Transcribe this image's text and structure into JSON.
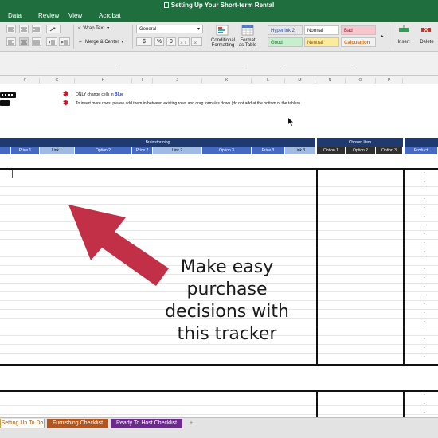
{
  "window": {
    "title": "Setting Up Your Short-term Rental"
  },
  "menu": [
    "Data",
    "Review",
    "View",
    "Acrobat"
  ],
  "ribbon": {
    "wrap_text": "Wrap Text",
    "merge_center": "Merge & Center",
    "number_format": "General",
    "currency": "$",
    "percent": "%",
    "comma": "9",
    "conditional_formatting": "Conditional Formatting",
    "format_as_table": "Format as Table",
    "styles": {
      "hyperlink2": "Hyperlink 2",
      "normal": "Normal",
      "bad": "Bad",
      "good": "Good",
      "neutral": "Neutral",
      "calculation": "Calculation"
    },
    "insert": "Insert",
    "delete": "Delete"
  },
  "columns": [
    "F",
    "G",
    "H",
    "I",
    "J",
    "K",
    "L",
    "M",
    "N",
    "O",
    "P"
  ],
  "notes": {
    "line1_prefix": "ONLY change cells in ",
    "line1_blue": "Blue",
    "line2": "To insert more rows, please add them in between existing rows and drag formulas down (do not add at the bottom of the tables)"
  },
  "table": {
    "group_brainstorming": "Brainstorming",
    "group_chosen": "Chosen Item",
    "headers": [
      "Price 1",
      "Link 1",
      "Option 2",
      "Price 2",
      "Link 2",
      "Option 3",
      "Price 3",
      "Link 3",
      "Option 1",
      "Option 2",
      "Option 3",
      "Product"
    ],
    "dash": "-"
  },
  "overlay": {
    "text": "Make easy purchase decisions with this tracker",
    "arrow_color": "#c13046"
  },
  "tabs": [
    {
      "label": "Setting Up To Do",
      "color": "#e3e3e3"
    },
    {
      "label": "Furnishing Checklist",
      "color": "#b3561e"
    },
    {
      "label": "Ready To Host Checklist",
      "color": "#6c2a8e"
    }
  ],
  "add_sheet": "+",
  "colors": {
    "title_bar": "#1e6e3e",
    "header_dark": "#1f3a6e",
    "header_blue": "#4669c2",
    "header_light_blue": "#9fbbe3",
    "chosen_dark": "#2f2f2f"
  }
}
